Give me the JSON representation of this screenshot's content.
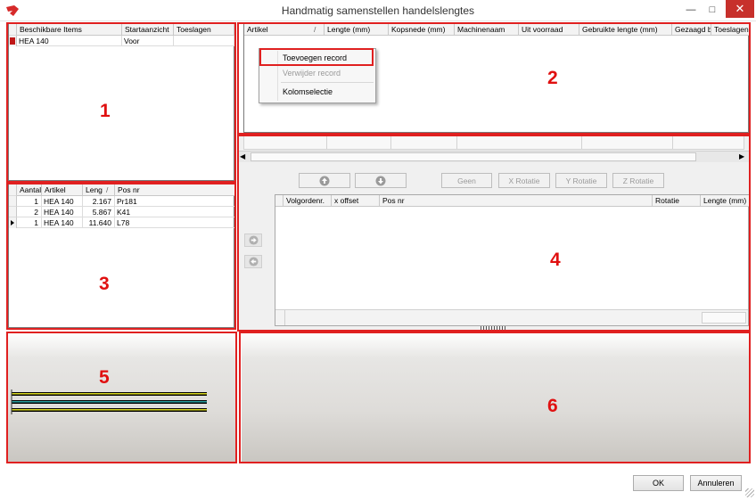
{
  "window": {
    "title": "Handmatig samenstellen handelslengtes"
  },
  "panel1": {
    "columns": [
      "Beschikbare Items",
      "Startaanzicht",
      "Toeslagen"
    ],
    "row": {
      "item": "HEA  140",
      "startaanzicht": "Voor",
      "toeslagen": ""
    }
  },
  "panel2": {
    "columns": [
      "Artikel",
      "Lengte (mm)",
      "Kopsnede (mm)",
      "Machinenaam",
      "Uit voorraad",
      "Gebruikte lengte (mm)",
      "Gezaagd b",
      "Toeslagen"
    ]
  },
  "context_menu": {
    "add": "Toevoegen record",
    "remove": "Verwijder record",
    "columns": "Kolomselectie"
  },
  "panel3": {
    "columns": [
      "Aantal",
      "Artikel",
      "Leng",
      "Pos nr"
    ],
    "rows": [
      {
        "aantal": "1",
        "artikel": "HEA  140",
        "lengte": "2.167",
        "posnr": "Pr181"
      },
      {
        "aantal": "2",
        "artikel": "HEA  140",
        "lengte": "5.867",
        "posnr": "K41"
      },
      {
        "aantal": "1",
        "artikel": "HEA  140",
        "lengte": "11.640",
        "posnr": "L78"
      }
    ]
  },
  "panel4": {
    "buttons": {
      "geen": "Geen",
      "x_rotatie": "X Rotatie",
      "y_rotatie": "Y Rotatie",
      "z_rotatie": "Z Rotatie"
    },
    "columns": [
      "Volgordenr.",
      "x offset",
      "Pos nr",
      "Rotatie",
      "Lengte (mm)"
    ]
  },
  "labels": {
    "p1": "1",
    "p2": "2",
    "p3": "3",
    "p4": "4",
    "p5": "5",
    "p6": "6"
  },
  "footer": {
    "ok": "OK",
    "cancel": "Annuleren"
  },
  "colors": {
    "highlight": "#e02020",
    "titlebar_close": "#c7302b",
    "beam_yellow": "#d8d820"
  }
}
